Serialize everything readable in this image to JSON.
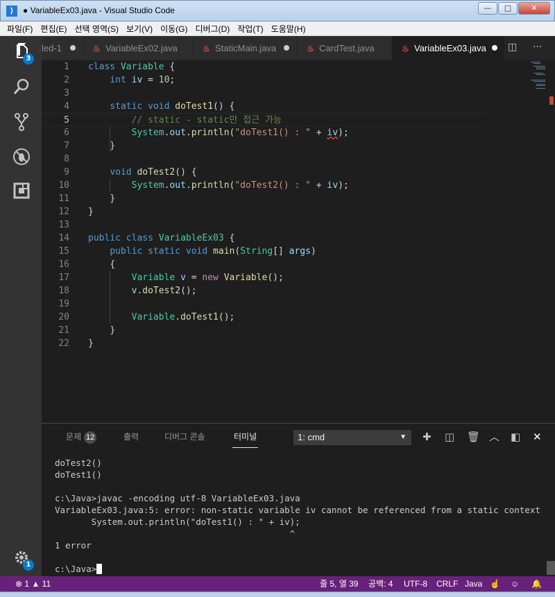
{
  "window": {
    "title": "● VariableEx03.java - Visual Studio Code",
    "buttons": {
      "minimize": "—",
      "maximize": "□",
      "close": "✕"
    }
  },
  "menu": [
    "파일(F)",
    "편집(E)",
    "선택 영역(S)",
    "보기(V)",
    "이동(G)",
    "디버그(D)",
    "작업(T)",
    "도움말(H)"
  ],
  "activity_bar": {
    "explorer_badge": "3",
    "settings_badge": "1"
  },
  "tabs": [
    {
      "label": "led-1",
      "dirty": true
    },
    {
      "label": "VariableEx02.java",
      "dirty": false
    },
    {
      "label": "StaticMain.java",
      "dirty": true
    },
    {
      "label": "CardTest.java",
      "dirty": false
    },
    {
      "label": "VariableEx03.java",
      "dirty": true,
      "active": true
    }
  ],
  "editor": {
    "language": "java",
    "current_line": 5,
    "lines": [
      "class Variable {",
      "    int iv = 10;",
      "",
      "    static void doTest1() {",
      "        // static - static만 접근 가능",
      "        System.out.println(\"doTest1() : \" + iv);",
      "    }",
      "",
      "    void doTest2() {",
      "        System.out.println(\"doTest2() : \" + iv);",
      "    }",
      "}",
      "",
      "public class VariableEx03 {",
      "    public static void main(String[] args)",
      "    {",
      "        Variable v = new Variable();",
      "        v.doTest2();",
      "",
      "        Variable.doTest1();",
      "    }",
      "}"
    ]
  },
  "panel": {
    "tabs": {
      "problems": "문제",
      "problems_count": "12",
      "output": "출력",
      "debug_console": "디버그 콘솔",
      "terminal": "터미널"
    },
    "terminal_select": "1: cmd",
    "terminal_lines": [
      "doTest2()",
      "doTest1()",
      "",
      "c:\\Java>javac -encoding utf-8 VariableEx03.java",
      "VariableEx03.java:5: error: non-static variable iv cannot be referenced from a static context",
      "       System.out.println(\"doTest1() : \" + iv);",
      "                                             ^",
      "1 error",
      "",
      "c:\\Java>"
    ]
  },
  "status_bar": {
    "errors": "1",
    "warnings": "11",
    "position": "줄 5, 열 39",
    "indent": "공백: 4",
    "encoding": "UTF-8",
    "eol": "CRLF",
    "language": "Java",
    "color": "#68217a"
  }
}
